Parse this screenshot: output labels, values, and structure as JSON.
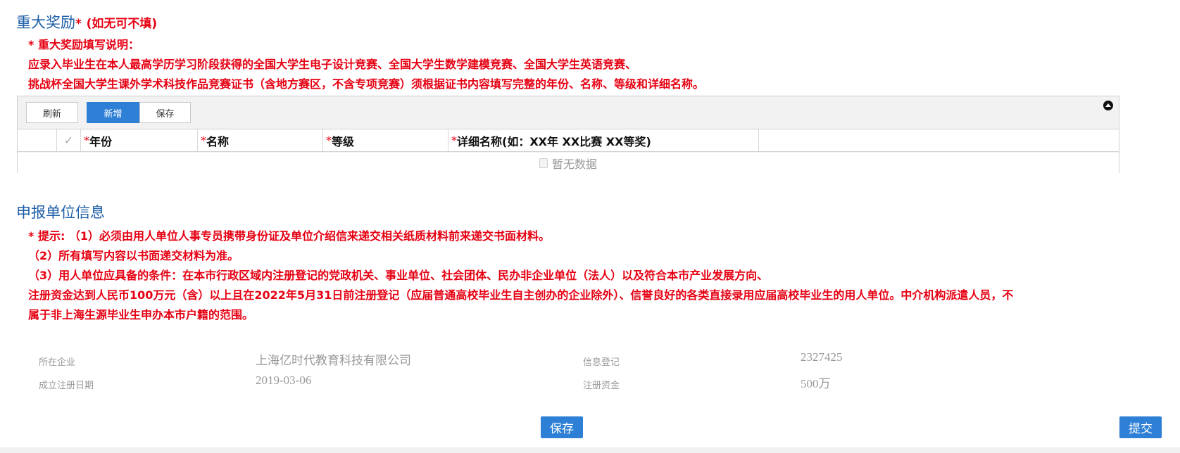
{
  "awards": {
    "title": "重大奖励",
    "required_mark": "*",
    "subtitle": "(如无可不填)",
    "notes": [
      "* 重大奖励填写说明：",
      "应录入毕业生在本人最高学历学习阶段获得的全国大学生电子设计竞赛、全国大学生数学建模竞赛、全国大学生英语竞赛、",
      "挑战杯全国大学生课外学术科技作品竞赛证书（含地方赛区，不含专项竞赛）须根据证书内容填写完整的年份、名称、等级和详细名称。"
    ],
    "toolbar": {
      "refresh": "刷新",
      "add": "新增",
      "save": "保存"
    },
    "columns": [
      {
        "star": "*",
        "label": "年份"
      },
      {
        "star": "*",
        "label": "名称"
      },
      {
        "star": "*",
        "label": "等级"
      },
      {
        "star": "*",
        "label": "详细名称(如：XX年 XX比赛 XX等奖)"
      }
    ],
    "check_mark": "✓",
    "empty_text": "暂无数据"
  },
  "unit": {
    "title": "申报单位信息",
    "notes": [
      "* 提示:   （1）必须由用人单位人事专员携带身份证及单位介绍信来递交相关纸质材料前来递交书面材料。",
      "（2）所有填写内容以书面递交材料为准。",
      "（3）用人单位应具备的条件：在本市行政区域内注册登记的党政机关、事业单位、社会团体、民办非企业单位（法人）以及符合本市产业发展方向、",
      "注册资金达到人民币100万元（含）以上且在2022年5月31日前注册登记（应届普通高校毕业生自主创办的企业除外）、信誉良好的各类直接录用应届高校毕业生的用人单位。中介机构派遣人员，不",
      "属于非上海生源毕业生申办本市户籍的范围。"
    ],
    "fields": {
      "company_label": "所在企业",
      "company_value": "上海亿时代教育科技有限公司",
      "info_label": "信息登记",
      "info_value": "2327425",
      "date_label": "成立注册日期",
      "date_value": "2019-03-06",
      "capital_label": "注册资金",
      "capital_value": "500万"
    }
  },
  "actions": {
    "save": "保存",
    "submit": "提交"
  },
  "colors": {
    "accent": "#2e7fd6",
    "title": "#1e5fa8",
    "warning": "#e60012"
  }
}
